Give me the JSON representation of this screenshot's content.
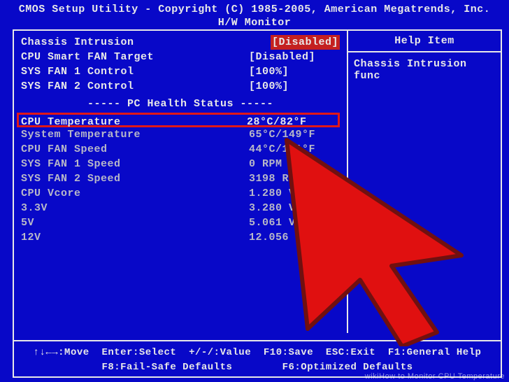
{
  "header": {
    "title": "CMOS Setup Utility - Copyright (C) 1985-2005, American Megatrends, Inc.",
    "page": "H/W Monitor"
  },
  "settings": [
    {
      "label": "Chassis Intrusion",
      "value": "[Disabled]",
      "highlight": true
    },
    {
      "label": "CPU Smart FAN Target",
      "value": "[Disabled]"
    },
    {
      "label": "SYS FAN 1 Control",
      "value": "[100%]"
    },
    {
      "label": "SYS FAN 2 Control",
      "value": "[100%]"
    }
  ],
  "section_title": "----- PC Health Status -----",
  "health": [
    {
      "label": "CPU Temperature",
      "value": "28°C/82°F",
      "boxed": true
    },
    {
      "label": "System Temperature",
      "value": "65°C/149°F",
      "dim": true
    },
    {
      "label": "CPU FAN Speed",
      "value": "44°C/111°F",
      "dim": true
    },
    {
      "label": "SYS FAN 1 Speed",
      "value": "0 RPM",
      "dim": true
    },
    {
      "label": "SYS FAN 2 Speed",
      "value": "3198 RPM",
      "dim": true
    },
    {
      "label": "CPU Vcore",
      "value": "1.280 V",
      "dim": true
    },
    {
      "label": "3.3V",
      "value": "3.280 V",
      "dim": true
    },
    {
      "label": "5V",
      "value": "5.061 V",
      "dim": true
    },
    {
      "label": "12V",
      "value": "12.056 V",
      "dim": true
    }
  ],
  "help": {
    "title": "Help Item",
    "body": "Chassis Intrusion func"
  },
  "footer": {
    "line1": "↑↓←→:Move  Enter:Select  +/-/:Value  F10:Save  ESC:Exit  F1:General Help",
    "line2": "F8:Fail-Safe Defaults        F6:Optimized Defaults"
  },
  "watermark": "wikiHow to Monitor CPU Temperature"
}
